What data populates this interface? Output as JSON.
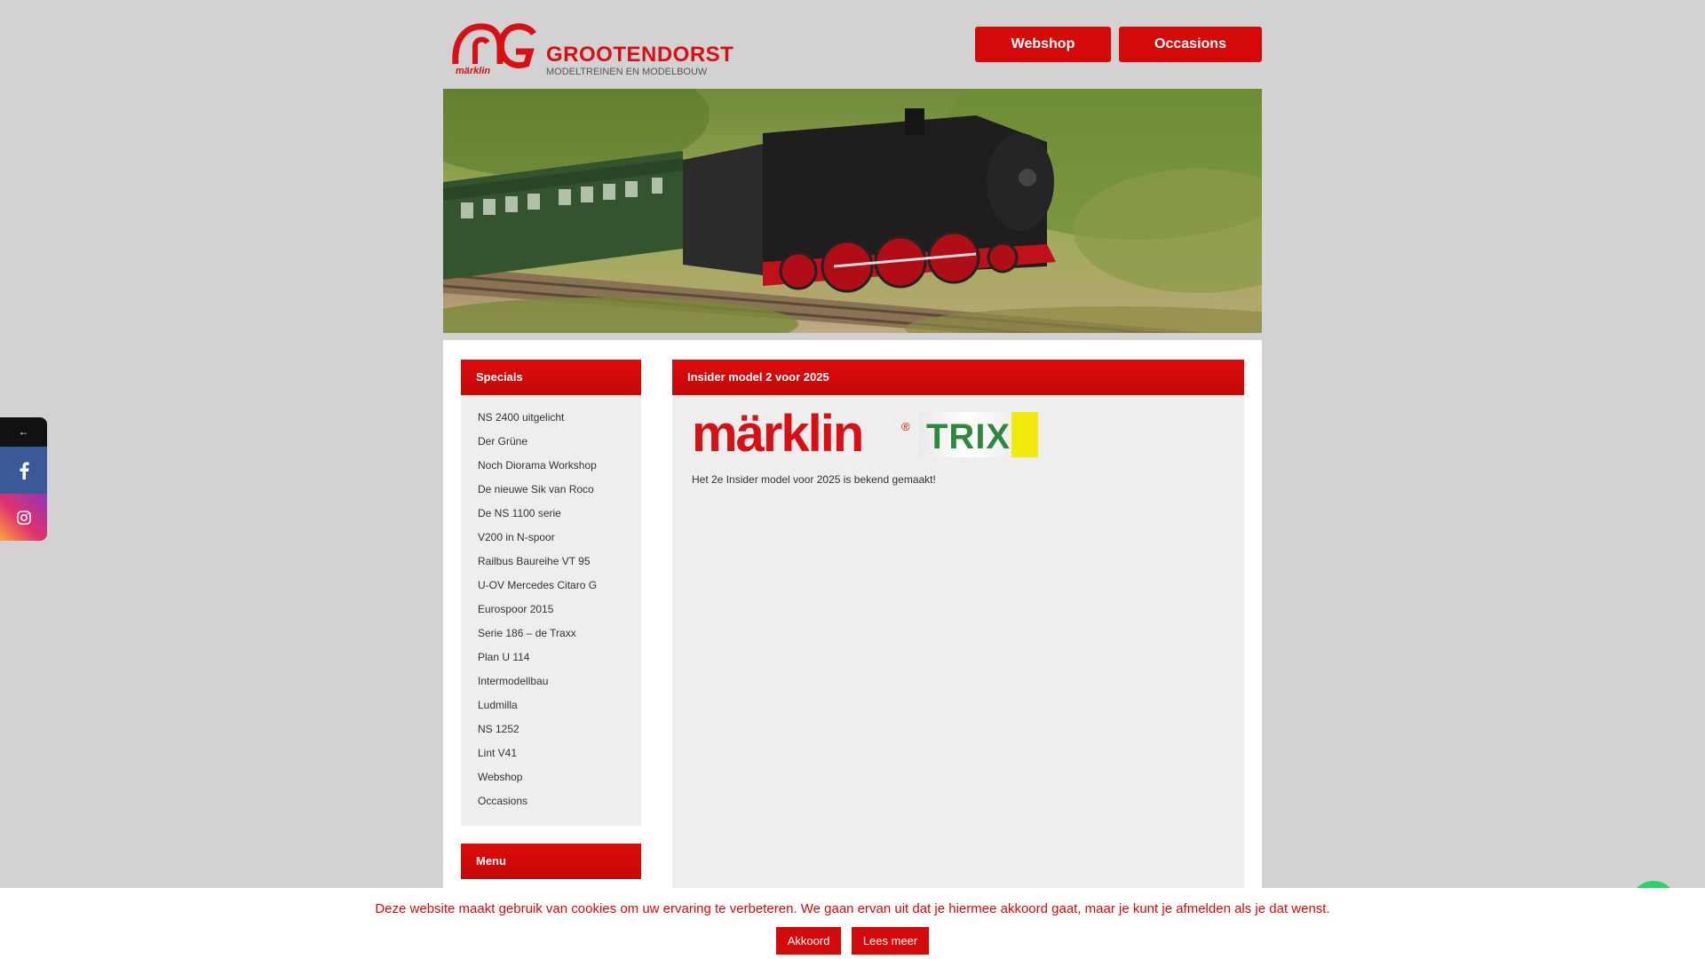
{
  "header": {
    "logo_name": "GROOTENDORST",
    "logo_tagline": "MODELTREINEN EN MODELBOUW",
    "logo_brand": "märklin",
    "webshop_label": "Webshop",
    "occasions_label": "Occasions"
  },
  "sidebar": {
    "specials_title": "Specials",
    "items": [
      {
        "label": "NS 2400 uitgelicht"
      },
      {
        "label": "Der Grüne"
      },
      {
        "label": "Noch Diorama Workshop"
      },
      {
        "label": "De nieuwe Sik van Roco"
      },
      {
        "label": "De NS 1100 serie"
      },
      {
        "label": "V200 in N-spoor"
      },
      {
        "label": "Railbus Baureihe VT 95"
      },
      {
        "label": "U-OV Mercedes Citaro G"
      },
      {
        "label": "Eurospoor 2015"
      },
      {
        "label": "Serie 186 – de Traxx"
      },
      {
        "label": "Plan U 114"
      },
      {
        "label": "Intermodellbau"
      },
      {
        "label": "Ludmilla"
      },
      {
        "label": "NS 1252"
      },
      {
        "label": "Lint V41"
      },
      {
        "label": "Webshop"
      },
      {
        "label": "Occasions"
      }
    ],
    "menu_title": "Menu"
  },
  "main": {
    "title": "Insider model 2 voor 2025",
    "marklin_logo": "märklin",
    "trix_logo": "TRIX",
    "intro": "Het 2e Insider model voor 2025 is bekend gemaakt!"
  },
  "social": {
    "back_label": "←",
    "facebook_icon": "facebook-icon",
    "instagram_icon": "instagram-icon"
  },
  "cookie": {
    "text": "Deze website maakt gebruik van cookies om uw ervaring te verbeteren. We gaan ervan uit dat je hiermee akkoord gaat, maar je kunt je afmelden als je dat wenst.",
    "accept_label": "Akkoord",
    "more_label": "Lees meer"
  },
  "colors": {
    "accent": "#d40a0a",
    "page_bg": "#d2d2d2",
    "panel_bg": "#eeeeee"
  }
}
